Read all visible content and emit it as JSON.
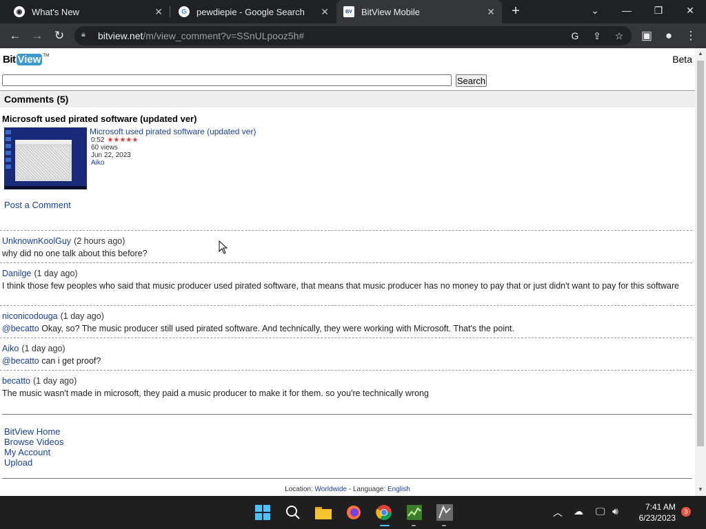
{
  "browser": {
    "tabs": [
      {
        "title": "What's New",
        "icon": "chrome-icon",
        "active": false
      },
      {
        "title": "pewdiepie - Google Search",
        "icon": "google-icon",
        "active": false
      },
      {
        "title": "BitView Mobile",
        "icon": "bitview-icon",
        "active": true
      }
    ],
    "url_domain": "bitview.net",
    "url_path": "/m/view_comment?v=SSnULpooz5h#"
  },
  "site": {
    "logo_bit": "Bit",
    "logo_view": "View",
    "logo_tm": "TM",
    "beta": "Beta",
    "search_placeholder": "",
    "search_button": "Search",
    "comments_header": "Comments (5)"
  },
  "video": {
    "title": "Microsoft used pirated software (updated ver)",
    "link_title": "Microsoft used pirated software (updated ver)",
    "duration": "0:52",
    "rating": 5,
    "stars": "★★★★★",
    "views": "60 views",
    "date": "Jun 22, 2023",
    "author": "Aiko"
  },
  "post_comment": "Post a Comment",
  "comments": [
    {
      "author": "UnknownKoolGuy",
      "time": "(2 hours ago)",
      "mention": "",
      "text": "why did no one talk about this before?"
    },
    {
      "author": "Danilge",
      "time": "(1 day ago)",
      "mention": "",
      "text": "I think those few peoples who said that music producer used pirated software, that means that music producer has no money to pay that or just didn't want to pay for this software"
    },
    {
      "author": "niconicodouga",
      "time": "(1 day ago)",
      "mention": "@becatto",
      "text": "Okay, so? The music producer still used pirated software. And technically, they were working with Microsoft. That's the point."
    },
    {
      "author": "Aiko",
      "time": "(1 day ago)",
      "mention": "@becatto",
      "text": "can i get proof?"
    },
    {
      "author": "becatto",
      "time": "(1 day ago)",
      "mention": "",
      "text": "The music wasn't made in microsoft, they paid a music producer to make it for them. so you're technically wrong"
    }
  ],
  "footer": {
    "links": [
      "BitView Home",
      "Browse Videos",
      "My Account",
      "Upload"
    ],
    "location_label": "Location:",
    "location_value": "Worldwide",
    "separator": "-",
    "language_label": "Language:",
    "language_value": "English"
  },
  "taskbar": {
    "time": "7:41 AM",
    "date": "6/23/2023",
    "notifications": "3"
  }
}
